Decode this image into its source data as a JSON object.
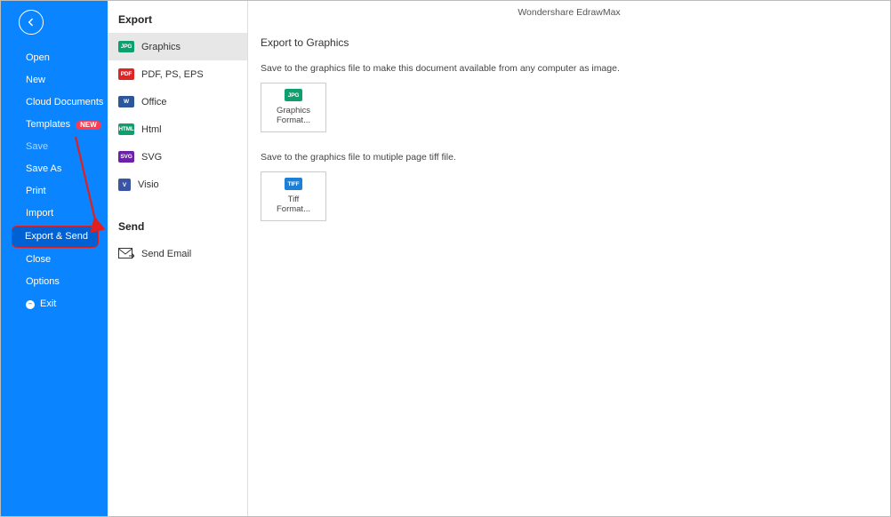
{
  "app_title": "Wondershare EdrawMax",
  "sidebar": {
    "items": [
      {
        "label": "Open"
      },
      {
        "label": "New"
      },
      {
        "label": "Cloud Documents"
      },
      {
        "label": "Templates",
        "badge": "NEW"
      },
      {
        "label": "Save"
      },
      {
        "label": "Save As"
      },
      {
        "label": "Print"
      },
      {
        "label": "Import"
      },
      {
        "label": "Export & Send"
      },
      {
        "label": "Close"
      },
      {
        "label": "Options"
      },
      {
        "label": "Exit"
      }
    ]
  },
  "midcol": {
    "export_title": "Export",
    "send_title": "Send",
    "export_items": [
      {
        "label": "Graphics",
        "badge": "JPG"
      },
      {
        "label": "PDF, PS, EPS",
        "badge": "PDF"
      },
      {
        "label": "Office",
        "badge": "W"
      },
      {
        "label": "Html",
        "badge": "HTML"
      },
      {
        "label": "SVG",
        "badge": "SVG"
      },
      {
        "label": "Visio",
        "badge": "V"
      }
    ],
    "send_items": [
      {
        "label": "Send Email"
      }
    ]
  },
  "content": {
    "heading": "Export to Graphics",
    "desc1": "Save to the graphics file to make this document available from any computer as image.",
    "tile1_badge": "JPG",
    "tile1_label": "Graphics\nFormat...",
    "desc2": "Save to the graphics file to mutiple page tiff file.",
    "tile2_badge": "TIFF",
    "tile2_label": "Tiff\nFormat..."
  }
}
